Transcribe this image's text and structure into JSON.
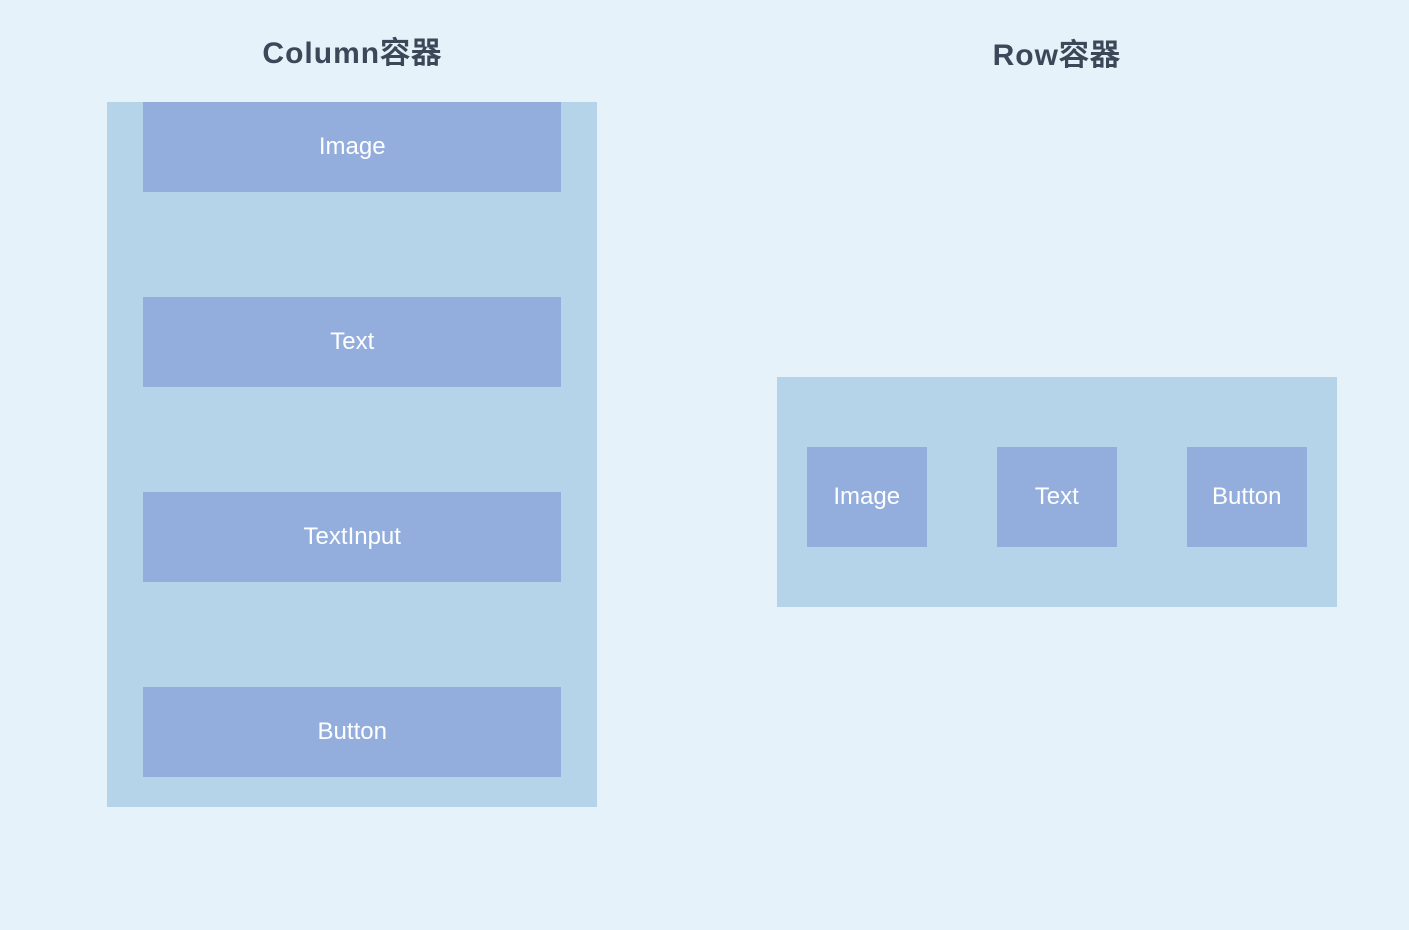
{
  "column": {
    "title": "Column容器",
    "items": [
      {
        "label": "Image"
      },
      {
        "label": "Text"
      },
      {
        "label": "TextInput"
      },
      {
        "label": "Button"
      }
    ]
  },
  "row": {
    "title": "Row容器",
    "items": [
      {
        "label": "Image"
      },
      {
        "label": "Text"
      },
      {
        "label": "Button"
      }
    ]
  }
}
